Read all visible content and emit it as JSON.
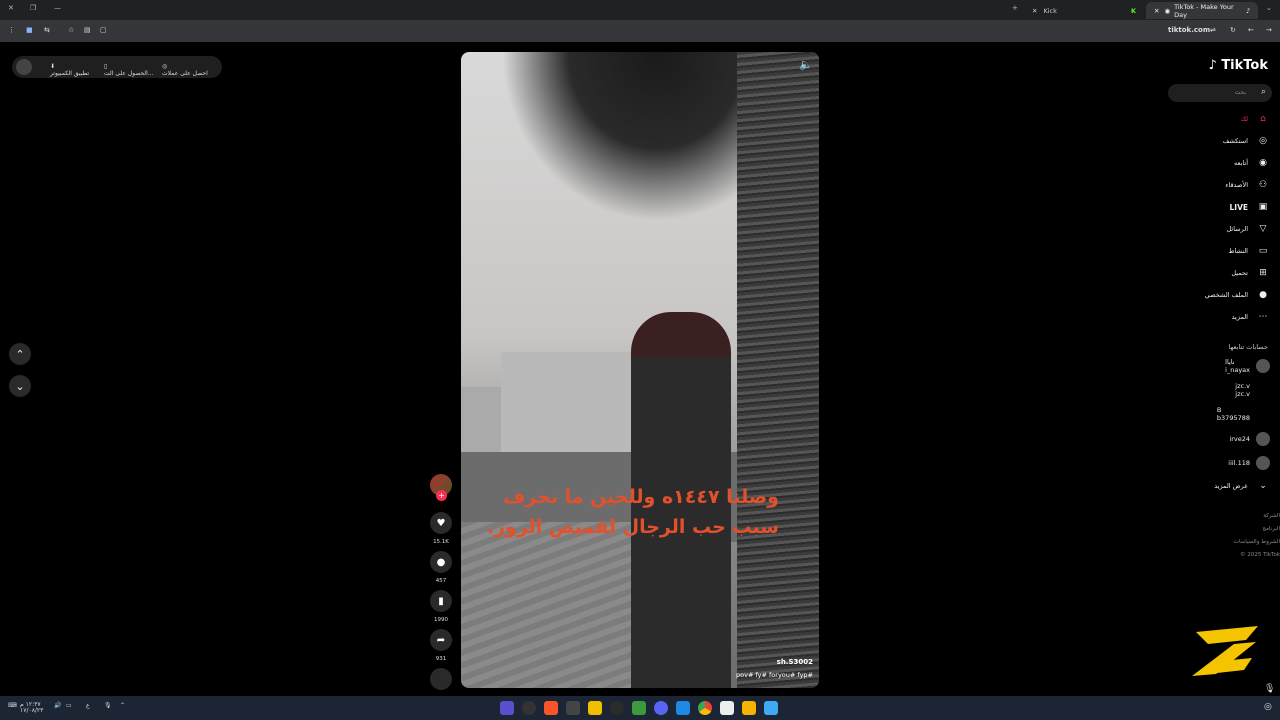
{
  "browser": {
    "tabs": [
      {
        "label": "Kick",
        "active": false
      },
      {
        "label": "TikTok - Make Your Day",
        "active": true
      }
    ],
    "address": "tiktok.com"
  },
  "topbar": {
    "items": [
      {
        "label": "احصل على عملات"
      },
      {
        "label": "الحصول على الت..."
      },
      {
        "label": "تطبيق الكمبيوتر"
      }
    ]
  },
  "video": {
    "caption_line1": "وصلنا ١٤٤٧ه وللحين ما نحرف",
    "caption_line2": "سبب حب الرجال لقميص الروز.",
    "author": "sh.S3002",
    "hashtags": "pov#  fy#  foryou#  fyp#"
  },
  "actions": {
    "likes": "15.1K",
    "comments": "457",
    "saves": "1990",
    "shares": "931"
  },
  "sidebar": {
    "logo": "TikTok",
    "search_placeholder": "بحث",
    "nav": [
      {
        "label": "لك",
        "icon": "home-icon"
      },
      {
        "label": "استكشف",
        "icon": "compass-icon"
      },
      {
        "label": "أتابعه",
        "icon": "following-icon"
      },
      {
        "label": "الأصدقاء",
        "icon": "friends-icon"
      },
      {
        "label": "LIVE",
        "icon": "live-icon"
      },
      {
        "label": "الرسائل",
        "icon": "messages-icon"
      },
      {
        "label": "النشاط",
        "icon": "activity-icon"
      },
      {
        "label": "تحميل",
        "icon": "upload-icon"
      },
      {
        "label": "الملف الشخصي",
        "icon": "profile-icon"
      },
      {
        "label": "المزيد",
        "icon": "more-icon"
      }
    ],
    "following_title": "حسابات تتابعها",
    "following": [
      {
        "name": "ناياا",
        "handle": "i_nayax"
      },
      {
        "name": "jzc.v",
        "handle": "jzc.v"
      },
      {
        "name": "B",
        "handle": "b3795788"
      },
      {
        "name": "irve24",
        "handle": ""
      },
      {
        "name": "iiil.118",
        "handle": ""
      }
    ],
    "see_more": "عرض المزيد",
    "footer": [
      "الشركة",
      "البرنامج",
      "الشروط والسياسات",
      "© 2025 TikTok"
    ]
  },
  "taskbar": {
    "time": "١٢:٣٧ م",
    "date": "١٧/٠٨/٢٣",
    "lang": "ع"
  },
  "colors": {
    "accent": "#fe2c55",
    "caption": "#e2502c",
    "background": "#000000"
  }
}
